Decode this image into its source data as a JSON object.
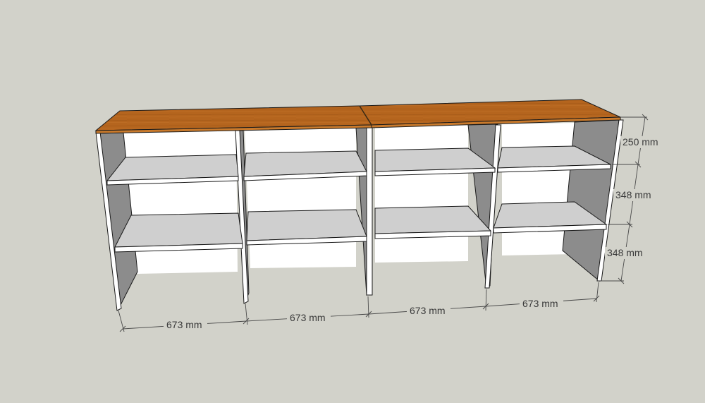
{
  "model": {
    "colors": {
      "background": "#d2d2ca",
      "top_face": "#b5651e",
      "top_edge": "#c97a2c",
      "panel_white": "#ffffff",
      "panel_shadow": "#8c8c8c",
      "shelf_top": "#cfcfcf",
      "outline": "#1a1a1a",
      "dimension_line": "#4a4a4a"
    },
    "dimensions": {
      "horizontal": [
        {
          "label": "673 mm"
        },
        {
          "label": "673 mm"
        },
        {
          "label": "673 mm"
        },
        {
          "label": "673 mm"
        }
      ],
      "vertical": [
        {
          "label": "250 mm"
        },
        {
          "label": "348 mm"
        },
        {
          "label": "348 mm"
        }
      ]
    }
  }
}
